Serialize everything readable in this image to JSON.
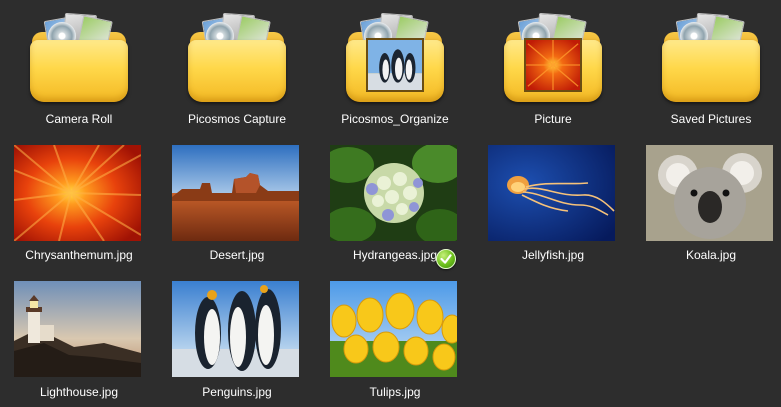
{
  "folders": [
    {
      "label": "Camera Roll",
      "thumb": "none"
    },
    {
      "label": "Picosmos Capture",
      "thumb": "none"
    },
    {
      "label": "Picosmos_Organize",
      "thumb": "penguins"
    },
    {
      "label": "Picture",
      "thumb": "flower"
    },
    {
      "label": "Saved Pictures",
      "thumb": "none"
    }
  ],
  "files": [
    {
      "label": "Chrysanthemum.jpg",
      "image": "chrysanthemum"
    },
    {
      "label": "Desert.jpg",
      "image": "desert"
    },
    {
      "label": "Hydrangeas.jpg",
      "image": "hydrangeas",
      "selected": true
    },
    {
      "label": "Jellyfish.jpg",
      "image": "jellyfish"
    },
    {
      "label": "Koala.jpg",
      "image": "koala"
    },
    {
      "label": "Lighthouse.jpg",
      "image": "lighthouse"
    },
    {
      "label": "Penguins.jpg",
      "image": "penguins"
    },
    {
      "label": "Tulips.jpg",
      "image": "tulips"
    }
  ],
  "colors": {
    "background": "#2d2d2d",
    "folder": "#ffd84a",
    "check": "#6cbf1c"
  }
}
